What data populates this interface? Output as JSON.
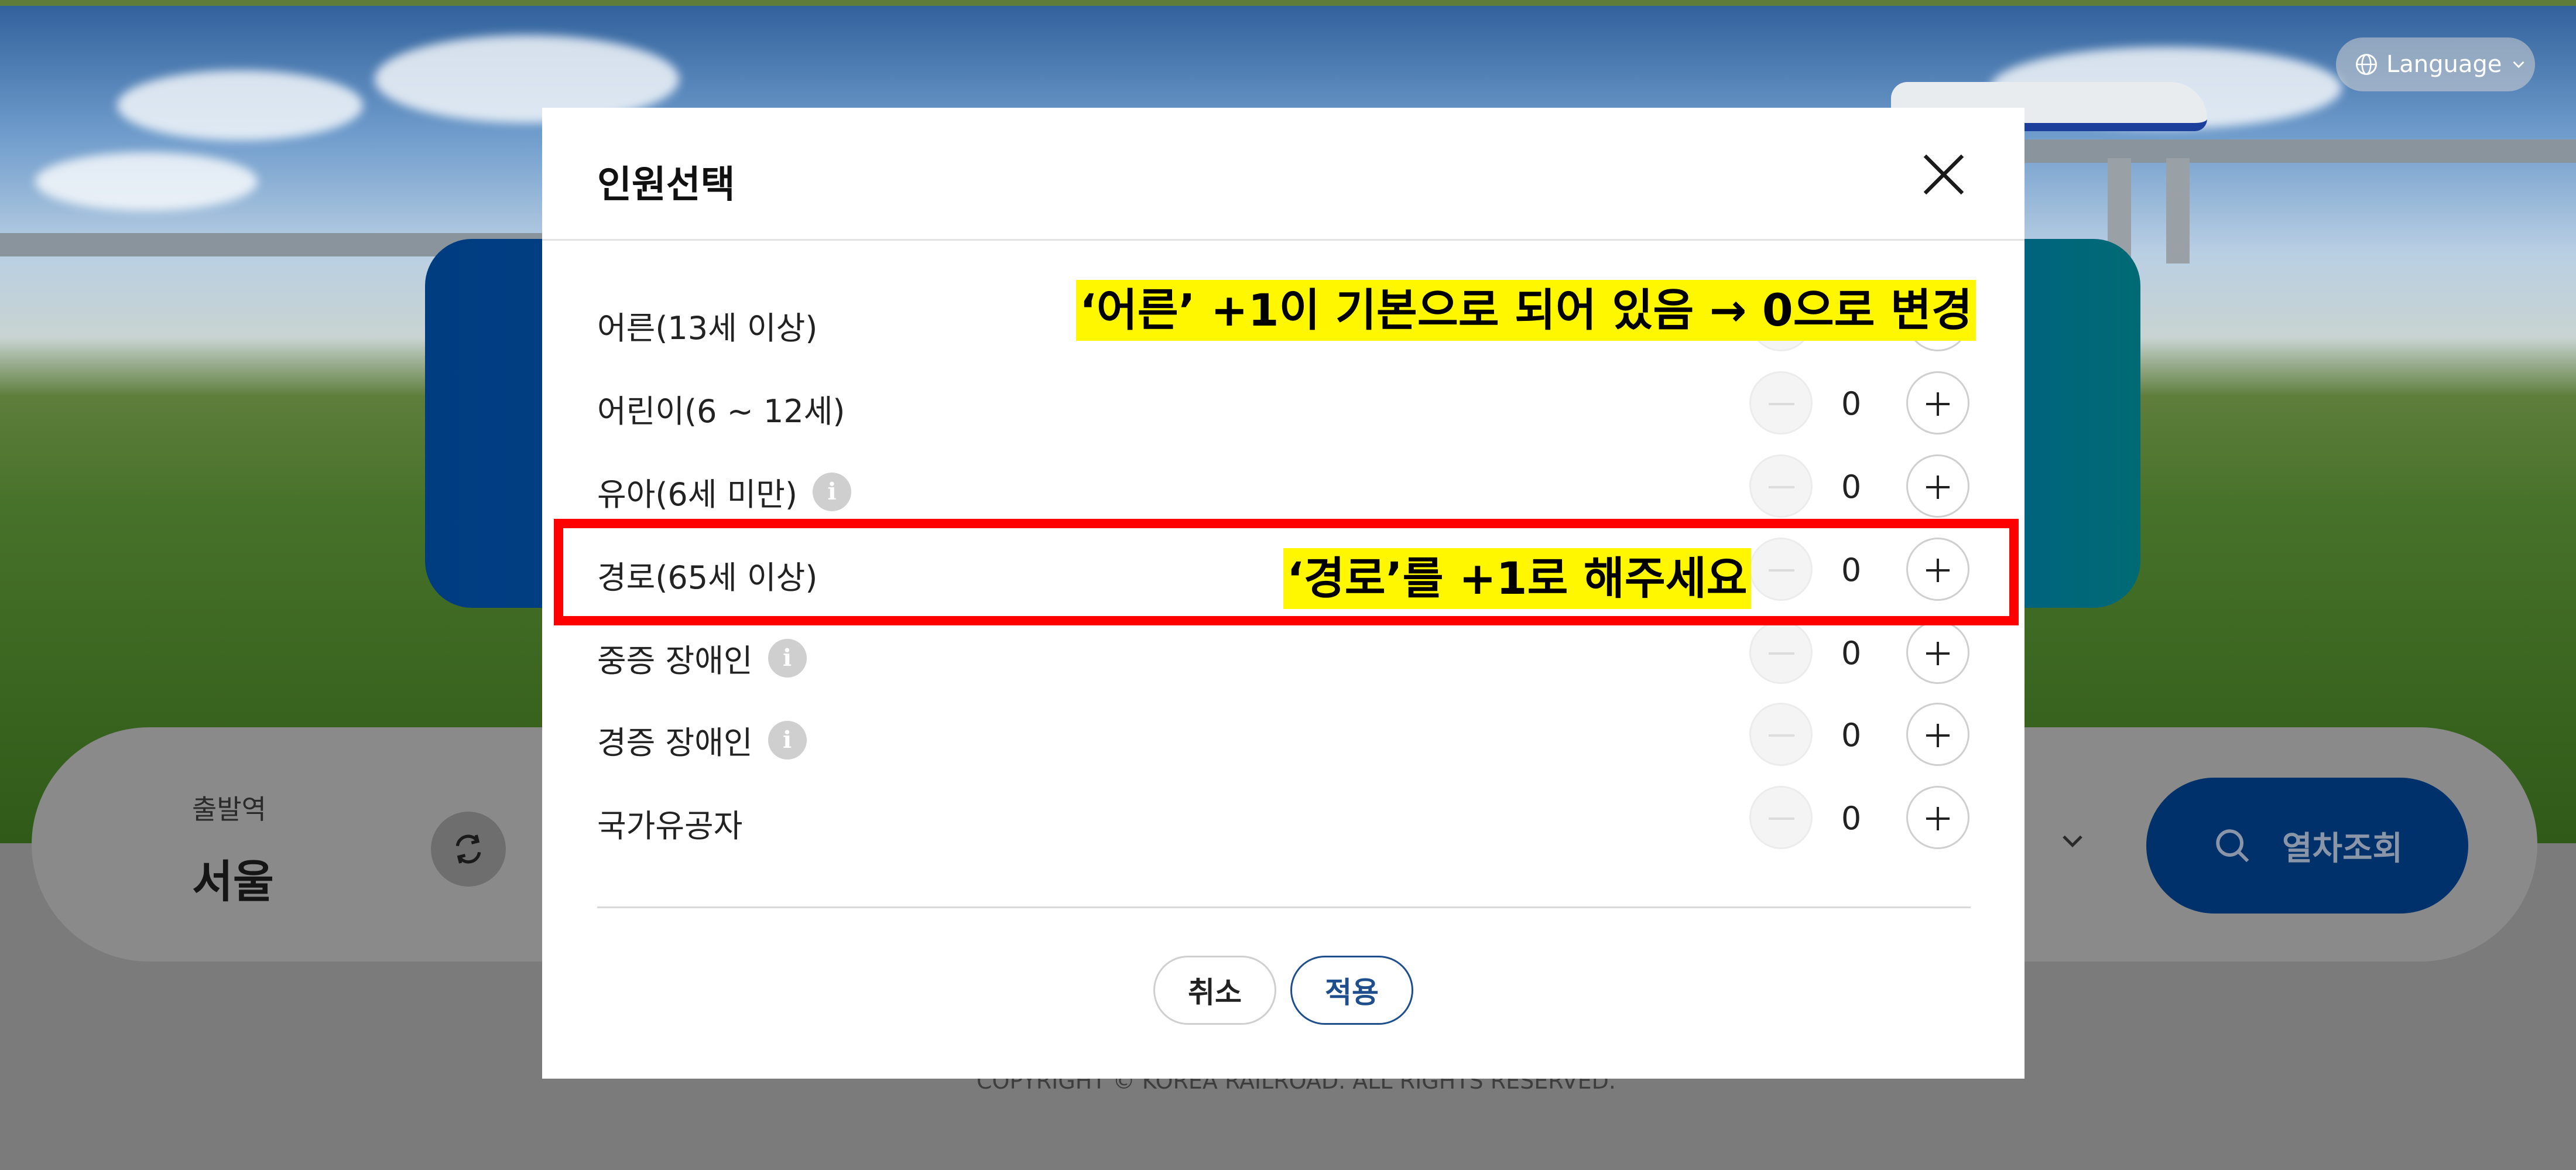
{
  "background": {
    "language_label": "Language",
    "departure_label": "출발역",
    "departure_value": "서울",
    "search_button_label": "열차조회",
    "copyright": "COPYRIGHT © KOREA RAILROAD. ALL RIGHTS RESERVED."
  },
  "modal": {
    "title": "인원선택",
    "rows": [
      {
        "label": "어른(13세 이상)",
        "count": "",
        "info": false
      },
      {
        "label": "어린이(6 ~ 12세)",
        "count": "0",
        "info": false
      },
      {
        "label": "유아(6세 미만)",
        "count": "0",
        "info": true
      },
      {
        "label": "경로(65세 이상)",
        "count": "0",
        "info": false
      },
      {
        "label": "중증 장애인",
        "count": "0",
        "info": true
      },
      {
        "label": "경증 장애인",
        "count": "0",
        "info": true
      },
      {
        "label": "국가유공자",
        "count": "0",
        "info": false
      }
    ],
    "cancel_label": "취소",
    "apply_label": "적용"
  },
  "annotations": {
    "note_adult": "‘어른’ +1이 기본으로 되어 있음 → 0으로 변경",
    "note_senior": "‘경로’를 +1로 해주세요",
    "highlight_color": "#fff700",
    "box_color": "#ff0000"
  },
  "colors": {
    "primary_navy": "#00316a",
    "apply_blue": "#1e4e8c"
  }
}
